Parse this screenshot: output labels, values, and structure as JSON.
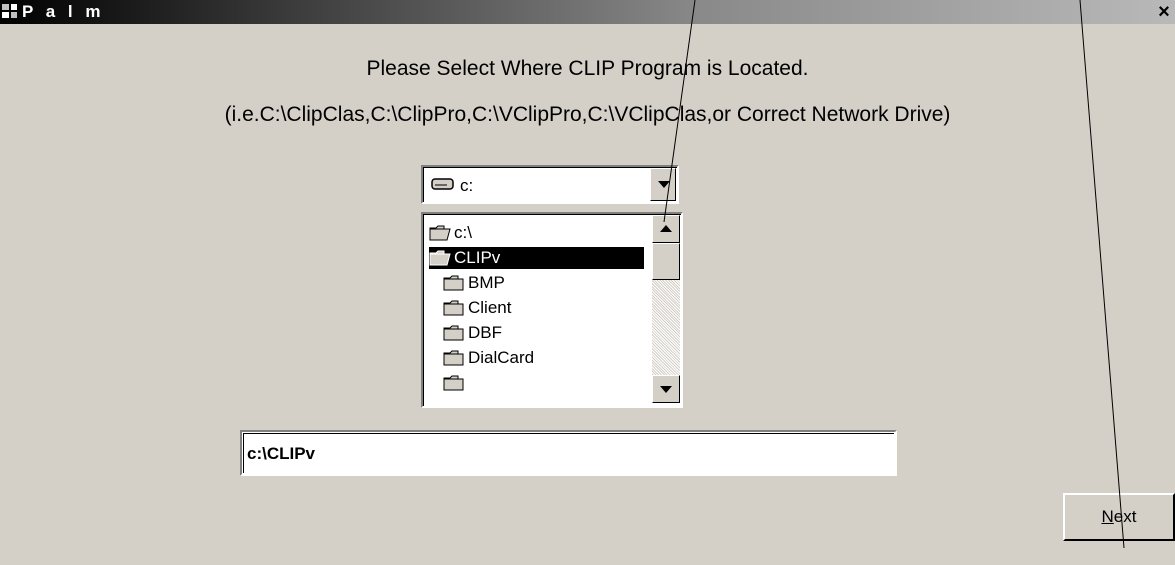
{
  "window": {
    "title": "P a l m",
    "close_glyph": "×"
  },
  "message": {
    "line1": "Please Select Where CLIP Program is Located.",
    "line2": "(i.e.C:\\ClipClas,C:\\ClipPro,C:\\VClipPro,C:\\VClipClas,or Correct Network Drive)"
  },
  "drive_select": {
    "value": "c:",
    "icon": "drive-icon"
  },
  "directory_list": {
    "items": [
      {
        "label": "c:\\",
        "icon": "open-folder-icon",
        "selected": false
      },
      {
        "label": "CLIPv",
        "icon": "open-folder-icon",
        "selected": true
      },
      {
        "label": "BMP",
        "icon": "folder-icon",
        "selected": false
      },
      {
        "label": "Client",
        "icon": "folder-icon",
        "selected": false
      },
      {
        "label": "DBF",
        "icon": "folder-icon",
        "selected": false
      },
      {
        "label": "DialCard",
        "icon": "folder-icon",
        "selected": false
      }
    ]
  },
  "path_field": {
    "value": "c:\\CLIPv"
  },
  "buttons": {
    "next_mnemonic": "N",
    "next_rest": "ext"
  },
  "colors": {
    "face": "#d4d0c8",
    "selection": "#000000",
    "title_start": "#000000",
    "title_end": "#b9b9b9"
  }
}
